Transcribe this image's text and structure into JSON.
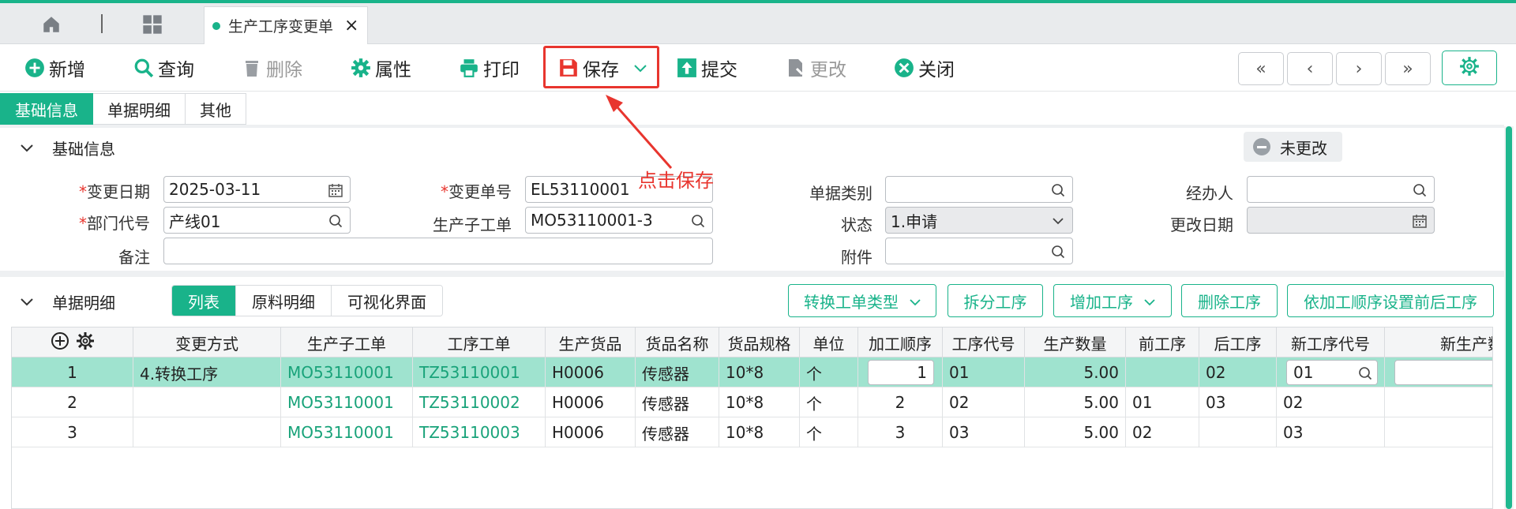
{
  "tabbar": {
    "doc_tab_label": "生产工序变更单"
  },
  "toolbar": {
    "add": "新增",
    "query": "查询",
    "delete": "删除",
    "props": "属性",
    "print": "打印",
    "save": "保存",
    "submit": "提交",
    "modify": "更改",
    "close": "关闭"
  },
  "nav": {
    "first": "«",
    "prev": "‹",
    "next": "›",
    "last": "»"
  },
  "section_tabs": [
    "基础信息",
    "单据明细",
    "其他"
  ],
  "basic": {
    "title": "基础信息",
    "status_badge": "未更改",
    "fields": {
      "change_date_label": "变更日期",
      "change_date": "2025-03-11",
      "change_no_label": "变更单号",
      "change_no": "EL53110001",
      "doc_type_label": "单据类别",
      "doc_type": "",
      "handler_label": "经办人",
      "handler": "",
      "dept_label": "部门代号",
      "dept": "产线01",
      "sub_order_label": "生产子工单",
      "sub_order": "MO53110001-3",
      "status_label": "状态",
      "status": "1.申请",
      "modify_date_label": "更改日期",
      "modify_date": "",
      "remark_label": "备注",
      "remark": "",
      "attach_label": "附件",
      "attach": ""
    },
    "required_mark": "*"
  },
  "annotation": "点击保存",
  "detail": {
    "title": "单据明细",
    "tabs": [
      "列表",
      "原料明细",
      "可视化界面"
    ],
    "actions": [
      "转换工单类型",
      "拆分工序",
      "增加工序",
      "删除工序",
      "依加工顺序设置前后工序"
    ],
    "columns": [
      "变更方式",
      "生产子工单",
      "工序工单",
      "生产货品",
      "货品名称",
      "货品规格",
      "单位",
      "加工顺序",
      "工序代号",
      "生产数量",
      "前工序",
      "后工序",
      "新工序代号",
      "新生产数"
    ],
    "rows": [
      [
        "1",
        "4.转换工序",
        "MO53110001",
        "TZ53110001",
        "H0006",
        "传感器",
        "10*8",
        "个",
        "1",
        "01",
        "5.00",
        "",
        "02",
        "01",
        ""
      ],
      [
        "2",
        "",
        "MO53110001",
        "TZ53110002",
        "H0006",
        "传感器",
        "10*8",
        "个",
        "2",
        "02",
        "5.00",
        "01",
        "03",
        "02",
        ""
      ],
      [
        "3",
        "",
        "MO53110001",
        "TZ53110003",
        "H0006",
        "传感器",
        "10*8",
        "个",
        "3",
        "03",
        "5.00",
        "02",
        "",
        "03",
        ""
      ]
    ]
  },
  "colors": {
    "accent": "#19b38a",
    "annotation": "#e8352e",
    "selected_row": "#9fe3cf"
  }
}
